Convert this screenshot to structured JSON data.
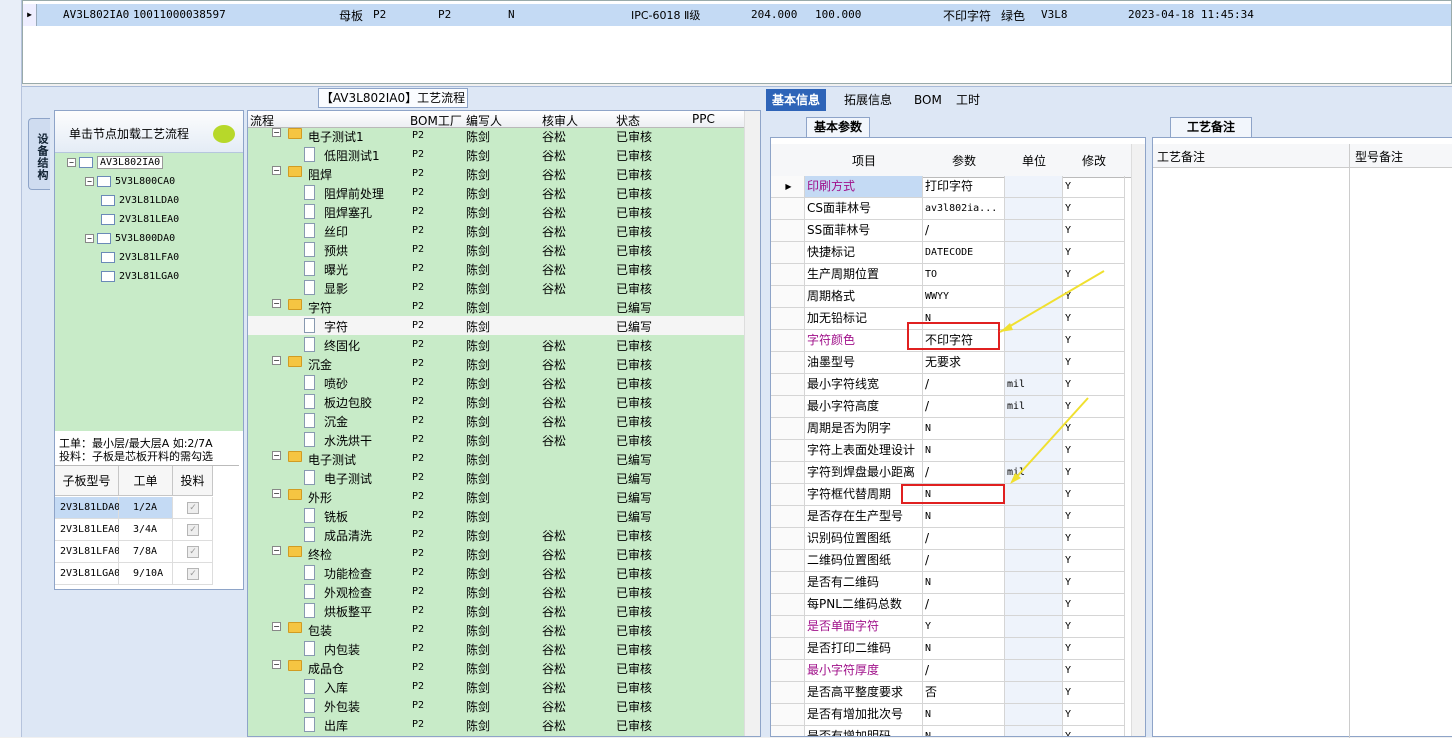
{
  "top_row": {
    "code": "AV3L802IA0",
    "num": "10011000038597",
    "type": "母板",
    "c1": "P2",
    "c2": "P2",
    "c3": "N",
    "grade": "IPC-6018 Ⅱ级",
    "v1": "204.000",
    "v2": "100.000",
    "char": "不印字符",
    "color": "绿色",
    "ver": "V3L8",
    "time": "2023-04-18 11:45:34"
  },
  "left_vtab": "设备结构",
  "left_panel": {
    "header": "单击节点加载工艺流程",
    "tree": [
      {
        "label": "AV3L802IA0",
        "level": 0
      },
      {
        "label": "5V3L800CA0",
        "level": 1
      },
      {
        "label": "2V3L81LDA0",
        "level": 2
      },
      {
        "label": "2V3L81LEA0",
        "level": 2
      },
      {
        "label": "5V3L800DA0",
        "level": 1
      },
      {
        "label": "2V3L81LFA0",
        "level": 2
      },
      {
        "label": "2V3L81LGA0",
        "level": 2
      }
    ],
    "info1": "工单：最小层/最大层A 如:2/7A",
    "info2": "投料：子板是芯板开料的需勾选",
    "sub_headers": [
      "子板型号",
      "工单",
      "投料"
    ],
    "sub_rows": [
      {
        "code": "2V3L81LDA0",
        "order": "1/2A"
      },
      {
        "code": "2V3L81LEA0",
        "order": "3/4A"
      },
      {
        "code": "2V3L81LFA0",
        "order": "7/8A"
      },
      {
        "code": "2V3L81LGA0",
        "order": "9/10A"
      }
    ]
  },
  "process": {
    "title": "【AV3L802IA0】工艺流程",
    "headers": [
      "流程",
      "BOM工厂",
      "编写人",
      "核审人",
      "状态",
      "PPC"
    ],
    "rows": [
      {
        "t": "f",
        "n": "电子测试1",
        "b": "P2",
        "w": "陈剑",
        "a": "谷松",
        "s": "已审核"
      },
      {
        "t": "d",
        "n": "低阻测试1",
        "b": "P2",
        "w": "陈剑",
        "a": "谷松",
        "s": "已审核"
      },
      {
        "t": "f",
        "n": "阻焊",
        "b": "P2",
        "w": "陈剑",
        "a": "谷松",
        "s": "已审核"
      },
      {
        "t": "d",
        "n": "阻焊前处理",
        "b": "P2",
        "w": "陈剑",
        "a": "谷松",
        "s": "已审核"
      },
      {
        "t": "d",
        "n": "阻焊塞孔",
        "b": "P2",
        "w": "陈剑",
        "a": "谷松",
        "s": "已审核"
      },
      {
        "t": "d",
        "n": "丝印",
        "b": "P2",
        "w": "陈剑",
        "a": "谷松",
        "s": "已审核"
      },
      {
        "t": "d",
        "n": "预烘",
        "b": "P2",
        "w": "陈剑",
        "a": "谷松",
        "s": "已审核"
      },
      {
        "t": "d",
        "n": "曝光",
        "b": "P2",
        "w": "陈剑",
        "a": "谷松",
        "s": "已审核"
      },
      {
        "t": "d",
        "n": "显影",
        "b": "P2",
        "w": "陈剑",
        "a": "谷松",
        "s": "已审核"
      },
      {
        "t": "f",
        "n": "字符",
        "b": "P2",
        "w": "陈剑",
        "a": "",
        "s": "已编写"
      },
      {
        "t": "d",
        "n": "字符",
        "b": "P2",
        "w": "陈剑",
        "a": "",
        "s": "已编写",
        "sel": true
      },
      {
        "t": "d",
        "n": "终固化",
        "b": "P2",
        "w": "陈剑",
        "a": "谷松",
        "s": "已审核"
      },
      {
        "t": "f",
        "n": "沉金",
        "b": "P2",
        "w": "陈剑",
        "a": "谷松",
        "s": "已审核"
      },
      {
        "t": "d",
        "n": "喷砂",
        "b": "P2",
        "w": "陈剑",
        "a": "谷松",
        "s": "已审核"
      },
      {
        "t": "d",
        "n": "板边包胶",
        "b": "P2",
        "w": "陈剑",
        "a": "谷松",
        "s": "已审核"
      },
      {
        "t": "d",
        "n": "沉金",
        "b": "P2",
        "w": "陈剑",
        "a": "谷松",
        "s": "已审核"
      },
      {
        "t": "d",
        "n": "水洗烘干",
        "b": "P2",
        "w": "陈剑",
        "a": "谷松",
        "s": "已审核"
      },
      {
        "t": "f",
        "n": "电子测试",
        "b": "P2",
        "w": "陈剑",
        "a": "",
        "s": "已编写"
      },
      {
        "t": "d",
        "n": "电子测试",
        "b": "P2",
        "w": "陈剑",
        "a": "",
        "s": "已编写"
      },
      {
        "t": "f",
        "n": "外形",
        "b": "P2",
        "w": "陈剑",
        "a": "",
        "s": "已编写"
      },
      {
        "t": "d",
        "n": "铣板",
        "b": "P2",
        "w": "陈剑",
        "a": "",
        "s": "已编写"
      },
      {
        "t": "d",
        "n": "成品清洗",
        "b": "P2",
        "w": "陈剑",
        "a": "谷松",
        "s": "已审核"
      },
      {
        "t": "f",
        "n": "终检",
        "b": "P2",
        "w": "陈剑",
        "a": "谷松",
        "s": "已审核"
      },
      {
        "t": "d",
        "n": "功能检查",
        "b": "P2",
        "w": "陈剑",
        "a": "谷松",
        "s": "已审核"
      },
      {
        "t": "d",
        "n": "外观检查",
        "b": "P2",
        "w": "陈剑",
        "a": "谷松",
        "s": "已审核"
      },
      {
        "t": "d",
        "n": "烘板整平",
        "b": "P2",
        "w": "陈剑",
        "a": "谷松",
        "s": "已审核"
      },
      {
        "t": "f",
        "n": "包装",
        "b": "P2",
        "w": "陈剑",
        "a": "谷松",
        "s": "已审核"
      },
      {
        "t": "d",
        "n": "内包装",
        "b": "P2",
        "w": "陈剑",
        "a": "谷松",
        "s": "已审核"
      },
      {
        "t": "f",
        "n": "成品仓",
        "b": "P2",
        "w": "陈剑",
        "a": "谷松",
        "s": "已审核"
      },
      {
        "t": "d",
        "n": "入库",
        "b": "P2",
        "w": "陈剑",
        "a": "谷松",
        "s": "已审核"
      },
      {
        "t": "d",
        "n": "外包装",
        "b": "P2",
        "w": "陈剑",
        "a": "谷松",
        "s": "已审核"
      },
      {
        "t": "d",
        "n": "出库",
        "b": "P2",
        "w": "陈剑",
        "a": "谷松",
        "s": "已审核"
      }
    ]
  },
  "right_tabs": [
    "基本信息",
    "拓展信息",
    "BOM",
    "工时"
  ],
  "basic_tab": "基本参数",
  "param_headers": [
    "项目",
    "参数",
    "单位",
    "修改"
  ],
  "params": [
    {
      "item": "印刷方式",
      "val": "打印字符",
      "unit": "",
      "mod": "Y",
      "hl": true,
      "cur": true
    },
    {
      "item": "CS面菲林号",
      "val": "av3l802ia...",
      "unit": "",
      "mod": "Y",
      "mono": true
    },
    {
      "item": "SS面菲林号",
      "val": "/",
      "unit": "",
      "mod": "Y"
    },
    {
      "item": "快捷标记",
      "val": "DATECODE",
      "unit": "",
      "mod": "Y",
      "mono": true
    },
    {
      "item": "生产周期位置",
      "val": "TO",
      "unit": "",
      "mod": "Y",
      "mono": true
    },
    {
      "item": "周期格式",
      "val": "WWYY",
      "unit": "",
      "mod": "Y",
      "mono": true
    },
    {
      "item": "加无铅标记",
      "val": "N",
      "unit": "",
      "mod": "Y",
      "mono": true
    },
    {
      "item": "字符颜色",
      "val": "不印字符",
      "unit": "",
      "mod": "Y",
      "hl": true
    },
    {
      "item": "油墨型号",
      "val": "无要求",
      "unit": "",
      "mod": "Y"
    },
    {
      "item": "最小字符线宽",
      "val": "/",
      "unit": "mil",
      "mod": "Y"
    },
    {
      "item": "最小字符高度",
      "val": "/",
      "unit": "mil",
      "mod": "Y"
    },
    {
      "item": "周期是否为阴字",
      "val": "N",
      "unit": "",
      "mod": "Y",
      "mono": true
    },
    {
      "item": "字符上表面处理设计",
      "val": "N",
      "unit": "",
      "mod": "Y",
      "mono": true
    },
    {
      "item": "字符到焊盘最小距离",
      "val": "/",
      "unit": "mil",
      "mod": "Y"
    },
    {
      "item": "字符框代替周期",
      "val": "N",
      "unit": "",
      "mod": "Y",
      "mono": true
    },
    {
      "item": "是否存在生产型号",
      "val": "N",
      "unit": "",
      "mod": "Y",
      "mono": true
    },
    {
      "item": "识别码位置图纸",
      "val": "/",
      "unit": "",
      "mod": "Y"
    },
    {
      "item": "二维码位置图纸",
      "val": "/",
      "unit": "",
      "mod": "Y"
    },
    {
      "item": "是否有二维码",
      "val": "N",
      "unit": "",
      "mod": "Y",
      "mono": true
    },
    {
      "item": "每PNL二维码总数",
      "val": "/",
      "unit": "",
      "mod": "Y"
    },
    {
      "item": "是否单面字符",
      "val": "Y",
      "unit": "",
      "mod": "Y",
      "hl": true,
      "mono": true
    },
    {
      "item": "是否打印二维码",
      "val": "N",
      "unit": "",
      "mod": "Y",
      "mono": true
    },
    {
      "item": "最小字符厚度",
      "val": "/",
      "unit": "",
      "mod": "Y",
      "hl": true
    },
    {
      "item": "是否高平整度要求",
      "val": "否",
      "unit": "",
      "mod": "Y"
    },
    {
      "item": "是否有增加批次号",
      "val": "N",
      "unit": "",
      "mod": "Y",
      "mono": true
    },
    {
      "item": "是否有增加明码",
      "val": "N",
      "unit": "",
      "mod": "Y",
      "mono": true
    }
  ],
  "note_tab": "工艺备注",
  "note_headers": [
    "工艺备注",
    "型号备注"
  ]
}
